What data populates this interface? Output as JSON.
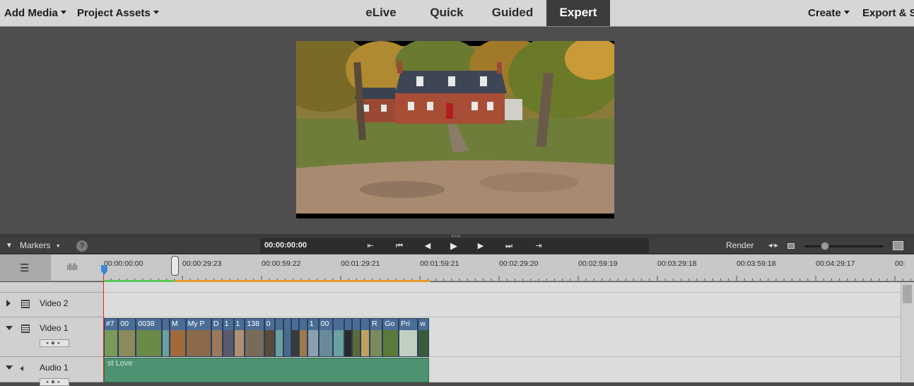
{
  "menu": {
    "add_media": "Add Media",
    "project_assets": "Project Assets",
    "create": "Create",
    "export": "Export & S"
  },
  "modes": [
    {
      "label": "eLive",
      "active": false
    },
    {
      "label": "Quick",
      "active": false
    },
    {
      "label": "Guided",
      "active": false
    },
    {
      "label": "Expert",
      "active": true
    }
  ],
  "toolbar": {
    "markers": "Markers",
    "help": "?",
    "timecode": "00:00:00:00",
    "render": "Render"
  },
  "ruler_labels": [
    "00:00:00:00",
    "00:00:29:23",
    "00:00:59:22",
    "00:01:29:21",
    "00:01:59:21",
    "00:02:29:20",
    "00:02:59:19",
    "00:03:29:18",
    "00:03:59:18",
    "00:04:29:17",
    "00:"
  ],
  "tracks": {
    "video2": "Video 2",
    "video1": "Video 1",
    "audio1": "Audio 1"
  },
  "video_clips": [
    {
      "label": "#7",
      "color": "#7a9a5a"
    },
    {
      "label": "00",
      "color": "#8a8a5a"
    },
    {
      "label": "0038",
      "color": "#6a8a4a"
    },
    {
      "label": "",
      "color": "#6aa0a0"
    },
    {
      "label": "M",
      "color": "#a06a3a"
    },
    {
      "label": "My P",
      "color": "#8a6a4a"
    },
    {
      "label": "D",
      "color": "#9a7a5a"
    },
    {
      "label": "1",
      "color": "#5a5a6a"
    },
    {
      "label": "1",
      "color": "#b09070"
    },
    {
      "label": "138",
      "color": "#7a6a5a"
    },
    {
      "label": "0",
      "color": "#5a4a3a"
    },
    {
      "label": "",
      "color": "#6aa0a0"
    },
    {
      "label": "",
      "color": "#4a6a8a"
    },
    {
      "label": "",
      "color": "#3a3a3a"
    },
    {
      "label": "",
      "color": "#a07a4a"
    },
    {
      "label": "1",
      "color": "#8aa0b0"
    },
    {
      "label": "00",
      "color": "#6a8a9a"
    },
    {
      "label": "",
      "color": "#6aa0a0"
    },
    {
      "label": "",
      "color": "#2a2a2a"
    },
    {
      "label": "",
      "color": "#5a6a3a"
    },
    {
      "label": "",
      "color": "#c0a060"
    },
    {
      "label": "R",
      "color": "#7a8a5a"
    },
    {
      "label": "Go",
      "color": "#5a7a3a"
    },
    {
      "label": "Pri",
      "color": "#c0d0c0"
    },
    {
      "label": "w",
      "color": "#3a5a3a"
    }
  ],
  "audio_clip_label": "st Love",
  "colors": {
    "topbar": "#d6d6d6",
    "active_tab": "#3c3c3c",
    "video_clip": "#4a6d96",
    "audio_clip": "#4f9271",
    "playhead": "#d03030"
  }
}
